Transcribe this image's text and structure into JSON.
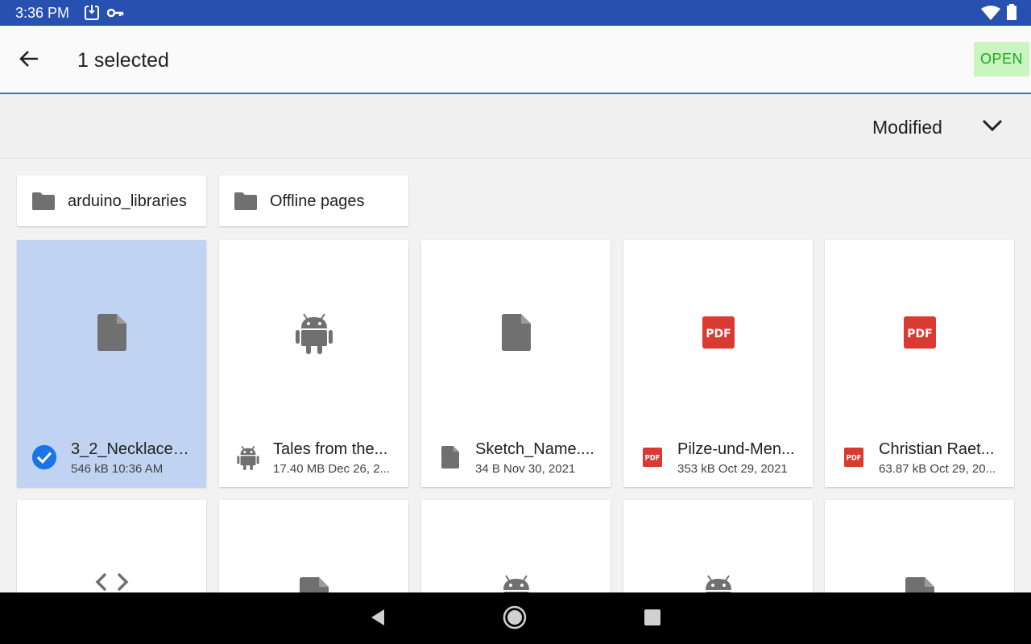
{
  "status_bar": {
    "time": "3:36 PM",
    "icons": [
      "screenshot-icon",
      "vpn-key-icon",
      "wifi-icon",
      "battery-icon"
    ]
  },
  "app_bar": {
    "back_icon": "arrow-back-icon",
    "title": "1 selected",
    "open_label": "OPEN"
  },
  "sort_bar": {
    "label": "Modified",
    "icon": "chevron-down-icon"
  },
  "folders": [
    {
      "label": "arduino_libraries",
      "icon": "folder-icon"
    },
    {
      "label": "Offline pages",
      "icon": "folder-icon"
    }
  ],
  "files": [
    {
      "name": "3_2_Necklace_...",
      "meta": "546 kB 10:36 AM",
      "type": "document",
      "selected": true
    },
    {
      "name": "Tales from the...",
      "meta": "17.40 MB Dec 26, 2...",
      "type": "android",
      "selected": false
    },
    {
      "name": "Sketch_Name....",
      "meta": "34 B Nov 30, 2021",
      "type": "document",
      "selected": false
    },
    {
      "name": "Pilze-und-Men...",
      "meta": "353 kB Oct 29, 2021",
      "type": "pdf",
      "selected": false
    },
    {
      "name": "Christian Raet...",
      "meta": "63.87 kB Oct 29, 20...",
      "type": "pdf",
      "selected": false
    }
  ],
  "files_row2_types": [
    "code",
    "document",
    "android",
    "android",
    "document"
  ],
  "pdf_label": "PDF",
  "colors": {
    "status_bar": "#2750b0",
    "selected_card": "#c0d3f3",
    "open_button_bg": "#c8f5c0",
    "open_button_text": "#1ea81e",
    "pdf_red": "#d93b32",
    "check_blue": "#1a73e8",
    "icon_gray": "#707070"
  },
  "nav_bar": {
    "buttons": [
      "back-triangle-icon",
      "home-circle-icon",
      "recents-square-icon"
    ]
  }
}
